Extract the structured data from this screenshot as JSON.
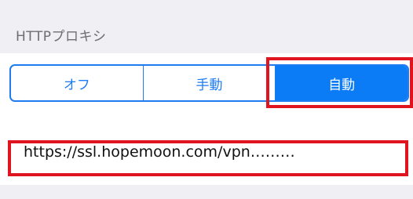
{
  "section": {
    "title": "HTTPプロキシ"
  },
  "proxy_mode": {
    "options": [
      "オフ",
      "手動",
      "自動"
    ],
    "selected": "自動"
  },
  "auto_config": {
    "url_value": "https://ssl.hopemoon.com/vpn………"
  },
  "colors": {
    "accent": "#0b7bf6",
    "highlight": "#e0141e",
    "background": "#efeff4"
  }
}
